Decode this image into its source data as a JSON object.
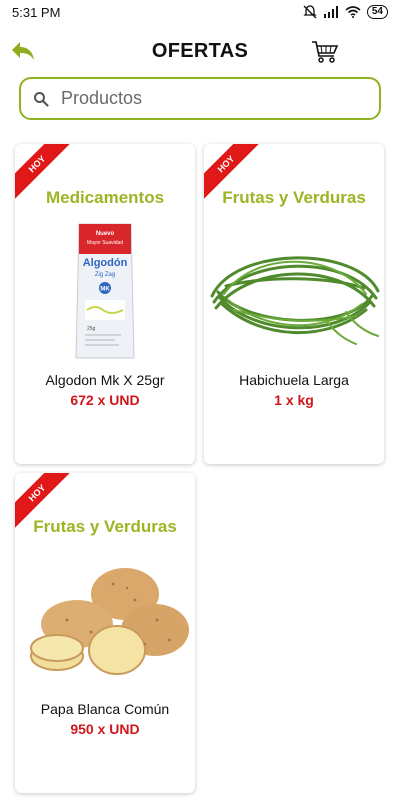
{
  "status_bar": {
    "time": "5:31 PM",
    "battery": "54"
  },
  "header": {
    "title": "OFERTAS"
  },
  "search": {
    "placeholder": "Productos"
  },
  "products": [
    {
      "badge": "HOY",
      "category": "Medicamentos",
      "name": "Algodon  Mk X 25gr",
      "price": "672 x UND",
      "package_text": [
        "Nuevo",
        "Mayor Suavidad",
        "Algodón",
        "Zig Zag",
        "MK",
        "25g"
      ]
    },
    {
      "badge": "HOY",
      "category": "Frutas y Verduras",
      "name": "Habichuela Larga",
      "price": "1 x kg"
    },
    {
      "badge": "HOY",
      "category": "Frutas y Verduras",
      "name": "Papa Blanca Común",
      "price": "950 x UND"
    }
  ],
  "colors": {
    "accent_green": "#9cb524",
    "price_red": "#d0161c",
    "ribbon_red": "#e01818"
  }
}
